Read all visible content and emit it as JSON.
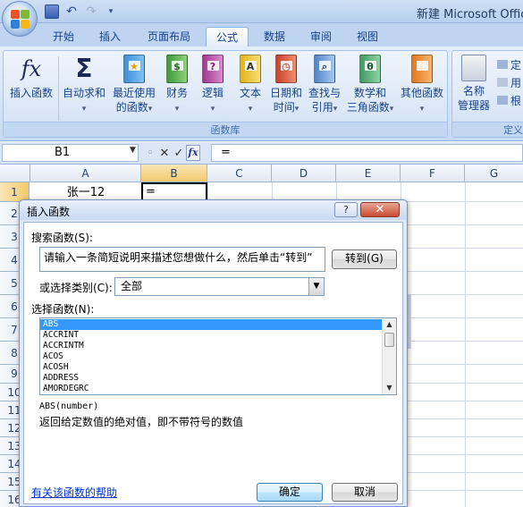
{
  "window": {
    "title": "新建 Microsoft Office"
  },
  "ribbon_tabs": [
    "开始",
    "插入",
    "页面布局",
    "公式",
    "数据",
    "审阅",
    "视图"
  ],
  "ribbon": {
    "insert_function": {
      "label": "插入函数",
      "icon": "fx"
    },
    "function_library": {
      "label": "函数库",
      "buttons": [
        {
          "line1": "自动求和",
          "line2": "",
          "icon_symbol": "Σ"
        },
        {
          "line1": "最近使用",
          "line2": "的函数",
          "icon_symbol": "★"
        },
        {
          "line1": "财务",
          "line2": "",
          "icon_symbol": "$"
        },
        {
          "line1": "逻辑",
          "line2": "",
          "icon_symbol": "?"
        },
        {
          "line1": "文本",
          "line2": "",
          "icon_symbol": "A"
        },
        {
          "line1": "日期和",
          "line2": "时间",
          "icon_symbol": "◷"
        },
        {
          "line1": "查找与",
          "line2": "引用",
          "icon_symbol": "⌕"
        },
        {
          "line1": "数学和",
          "line2": "三角函数",
          "icon_symbol": "θ"
        },
        {
          "line1": "其他函数",
          "line2": "",
          "icon_symbol": ""
        }
      ]
    },
    "defined_names": {
      "label": "定义",
      "name_manager": {
        "line1": "名称",
        "line2": "管理器"
      },
      "small_items": [
        "定",
        "用",
        "根"
      ]
    }
  },
  "formula_bar": {
    "name_box": "B1",
    "formula": "="
  },
  "sheet": {
    "columns": [
      "A",
      "B",
      "C",
      "D",
      "E",
      "F",
      "G"
    ],
    "rows": [
      "1",
      "2",
      "3",
      "4",
      "5",
      "6",
      "7",
      "8",
      "9",
      "10",
      "11",
      "12",
      "13",
      "14",
      "15",
      "16"
    ],
    "cell_a1": "张一12",
    "cell_b1": "="
  },
  "dialog": {
    "title": "插入函数",
    "help_button": "?",
    "close_button": "✕",
    "search_label": "搜索函数(S):",
    "search_text": "请输入一条简短说明来描述您想做什么，然后单击“转到”",
    "goto_button": "转到(G)",
    "category_label": "或选择类别(C):",
    "category_value": "全部",
    "function_label": "选择函数(N):",
    "functions": [
      "ABS",
      "ACCRINT",
      "ACCRINTM",
      "ACOS",
      "ACOSH",
      "ADDRESS",
      "AMORDEGRC"
    ],
    "selected_function": "ABS",
    "syntax": "ABS(number)",
    "description": "返回给定数值的绝对值，即不带符号的数值",
    "help_link": "有关该函数的帮助",
    "ok_button": "确定",
    "cancel_button": "取消"
  }
}
